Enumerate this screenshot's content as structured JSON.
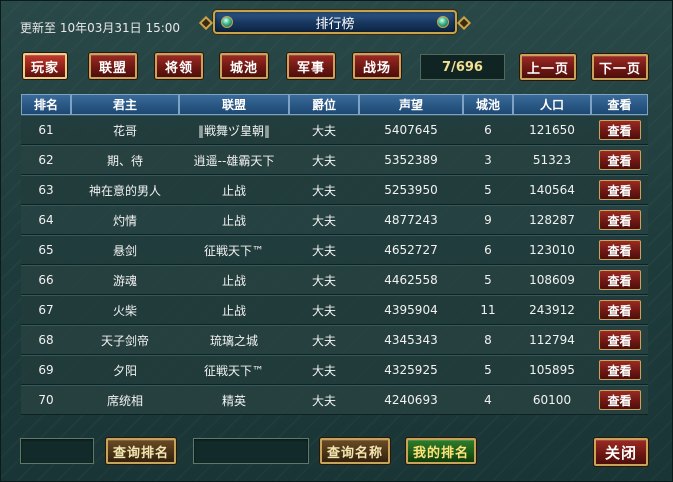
{
  "header": {
    "update_text": "更新至 10年03月31日 15:00",
    "title": "排行榜"
  },
  "tabs": [
    {
      "label": "玩家",
      "active": true
    },
    {
      "label": "联盟",
      "active": false
    },
    {
      "label": "将领",
      "active": false
    },
    {
      "label": "城池",
      "active": false
    },
    {
      "label": "军事",
      "active": false
    },
    {
      "label": "战场",
      "active": false
    }
  ],
  "pager": {
    "page_text": "7/696",
    "prev_label": "上一页",
    "next_label": "下一页"
  },
  "table": {
    "columns": [
      "排名",
      "君主",
      "联盟",
      "爵位",
      "声望",
      "城池",
      "人口",
      "查看"
    ],
    "view_label": "查看",
    "rows": [
      [
        "61",
        "花哥",
        "‖戦舞ヅ皇朝‖",
        "大夫",
        "5407645",
        "6",
        "121650"
      ],
      [
        "62",
        "期、待",
        "逍遥--雄霸天下",
        "大夫",
        "5352389",
        "3",
        "51323"
      ],
      [
        "63",
        "神在意的男人",
        "止战",
        "大夫",
        "5253950",
        "5",
        "140564"
      ],
      [
        "64",
        "灼情",
        "止战",
        "大夫",
        "4877243",
        "9",
        "128287"
      ],
      [
        "65",
        "悬剑",
        "征戦天下™",
        "大夫",
        "4652727",
        "6",
        "123010"
      ],
      [
        "66",
        "游魂",
        "止战",
        "大夫",
        "4462558",
        "5",
        "108609"
      ],
      [
        "67",
        "火柴",
        "止战",
        "大夫",
        "4395904",
        "11",
        "243912"
      ],
      [
        "68",
        "天子剑帝",
        "琉璃之城",
        "大夫",
        "4345343",
        "8",
        "112794"
      ],
      [
        "69",
        "夕阳",
        "征戦天下™",
        "大夫",
        "4325925",
        "5",
        "105895"
      ],
      [
        "70",
        "席统相",
        "精英",
        "大夫",
        "4240693",
        "4",
        "60100"
      ]
    ]
  },
  "footer": {
    "rank_input_value": "",
    "query_rank_label": "查询排名",
    "name_input_value": "",
    "query_name_label": "查询名称",
    "my_rank_label": "我的排名",
    "close_label": "关闭"
  }
}
